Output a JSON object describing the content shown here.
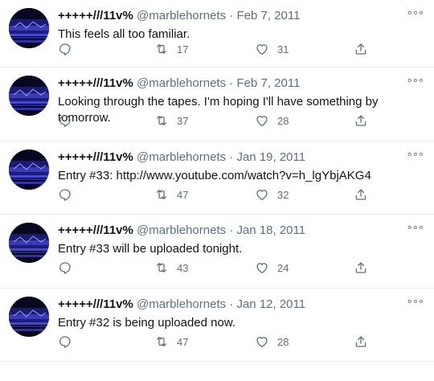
{
  "colors": {
    "text": "#0f1419",
    "muted": "#5b7083",
    "divider": "#e6ecf0"
  },
  "tweets": [
    {
      "name": "+++++///11v%",
      "handle": "@marblehornets",
      "dot": "·",
      "date": "Feb 7, 2011",
      "text": "This feels all too familiar.",
      "retweets": "17",
      "likes": "31"
    },
    {
      "name": "+++++///11v%",
      "handle": "@marblehornets",
      "dot": "·",
      "date": "Feb 7, 2011",
      "text": "Looking through the tapes. I'm hoping I'll have something by tomorrow.",
      "retweets": "37",
      "likes": "28"
    },
    {
      "name": "+++++///11v%",
      "handle": "@marblehornets",
      "dot": "·",
      "date": "Jan 19, 2011",
      "text": "Entry #33: http://www.youtube.com/watch?v=h_lgYbjAKG4",
      "retweets": "47",
      "likes": "32"
    },
    {
      "name": "+++++///11v%",
      "handle": "@marblehornets",
      "dot": "·",
      "date": "Jan 18, 2011",
      "text": "Entry #33 will be uploaded tonight.",
      "retweets": "43",
      "likes": "24"
    },
    {
      "name": "+++++///11v%",
      "handle": "@marblehornets",
      "dot": "·",
      "date": "Jan 12, 2011",
      "text": "Entry #32 is being uploaded now.",
      "retweets": "47",
      "likes": "28"
    }
  ]
}
